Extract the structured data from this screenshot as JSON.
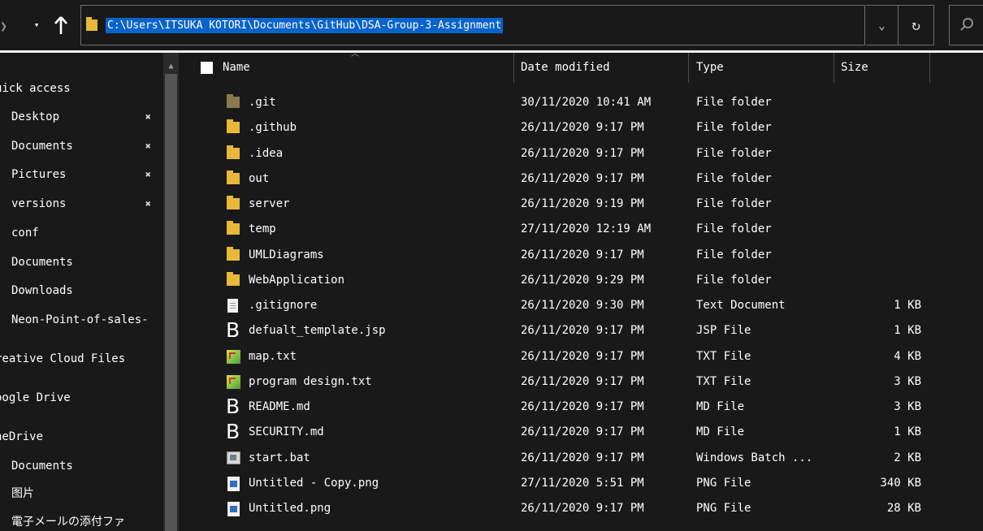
{
  "address_bar": {
    "path": "C:\\Users\\ITSUKA KOTORI\\Documents\\GitHub\\DSA-Group-3-Assignment"
  },
  "columns": {
    "name": "Name",
    "date": "Date modified",
    "type": "Type",
    "size": "Size"
  },
  "nav_pane": {
    "items": [
      {
        "label": "uick access",
        "pinned": false,
        "kind": "group"
      },
      {
        "label": "Desktop",
        "pinned": true,
        "kind": "sub"
      },
      {
        "label": "Documents",
        "pinned": true,
        "kind": "sub"
      },
      {
        "label": "Pictures",
        "pinned": true,
        "kind": "sub"
      },
      {
        "label": "versions",
        "pinned": true,
        "kind": "sub"
      },
      {
        "label": "conf",
        "pinned": false,
        "kind": "sub"
      },
      {
        "label": "Documents",
        "pinned": false,
        "kind": "sub"
      },
      {
        "label": "Downloads",
        "pinned": false,
        "kind": "sub"
      },
      {
        "label": "Neon-Point-of-sales-",
        "pinned": false,
        "kind": "sub"
      },
      {
        "label": "reative Cloud Files",
        "pinned": false,
        "kind": "group"
      },
      {
        "label": "oogle Drive",
        "pinned": false,
        "kind": "group"
      },
      {
        "label": "neDrive",
        "pinned": false,
        "kind": "group"
      },
      {
        "label": "Documents",
        "pinned": false,
        "kind": "sub"
      },
      {
        "label": "图片",
        "pinned": false,
        "kind": "sub"
      },
      {
        "label": "電子メールの添付ファ",
        "pinned": false,
        "kind": "sub"
      }
    ]
  },
  "files": [
    {
      "name": ".git",
      "date": "30/11/2020 10:41 AM",
      "type": "File folder",
      "size": "",
      "icon": "git-folder-icon"
    },
    {
      "name": ".github",
      "date": "26/11/2020 9:17 PM",
      "type": "File folder",
      "size": "",
      "icon": "folder-icon"
    },
    {
      "name": ".idea",
      "date": "26/11/2020 9:17 PM",
      "type": "File folder",
      "size": "",
      "icon": "folder-icon"
    },
    {
      "name": "out",
      "date": "26/11/2020 9:17 PM",
      "type": "File folder",
      "size": "",
      "icon": "folder-icon"
    },
    {
      "name": "server",
      "date": "26/11/2020 9:19 PM",
      "type": "File folder",
      "size": "",
      "icon": "folder-icon"
    },
    {
      "name": "temp",
      "date": "27/11/2020 12:19 AM",
      "type": "File folder",
      "size": "",
      "icon": "folder-icon"
    },
    {
      "name": "UMLDiagrams",
      "date": "26/11/2020 9:17 PM",
      "type": "File folder",
      "size": "",
      "icon": "folder-icon"
    },
    {
      "name": "WebApplication",
      "date": "26/11/2020 9:29 PM",
      "type": "File folder",
      "size": "",
      "icon": "folder-icon"
    },
    {
      "name": ".gitignore",
      "date": "26/11/2020 9:30 PM",
      "type": "Text Document",
      "size": "1 KB",
      "icon": "text-document-icon"
    },
    {
      "name": "defualt_template.jsp",
      "date": "26/11/2020 9:17 PM",
      "type": "JSP File",
      "size": "1 KB",
      "icon": "b-file-icon"
    },
    {
      "name": "map.txt",
      "date": "26/11/2020 9:17 PM",
      "type": "TXT File",
      "size": "4 KB",
      "icon": "txt-file-icon"
    },
    {
      "name": "program design.txt",
      "date": "26/11/2020 9:17 PM",
      "type": "TXT File",
      "size": "3 KB",
      "icon": "txt-file-icon"
    },
    {
      "name": "README.md",
      "date": "26/11/2020 9:17 PM",
      "type": "MD File",
      "size": "3 KB",
      "icon": "b-file-icon"
    },
    {
      "name": "SECURITY.md",
      "date": "26/11/2020 9:17 PM",
      "type": "MD File",
      "size": "1 KB",
      "icon": "b-file-icon"
    },
    {
      "name": "start.bat",
      "date": "26/11/2020 9:17 PM",
      "type": "Windows Batch ...",
      "size": "2 KB",
      "icon": "batch-file-icon"
    },
    {
      "name": "Untitled - Copy.png",
      "date": "27/11/2020 5:51 PM",
      "type": "PNG File",
      "size": "340 KB",
      "icon": "png-file-icon"
    },
    {
      "name": "Untitled.png",
      "date": "26/11/2020 9:17 PM",
      "type": "PNG File",
      "size": "28 KB",
      "icon": "png-file-icon"
    }
  ],
  "colors": {
    "background": "#191919",
    "selection": "#0a63c9",
    "folder": "#e9b83b"
  }
}
